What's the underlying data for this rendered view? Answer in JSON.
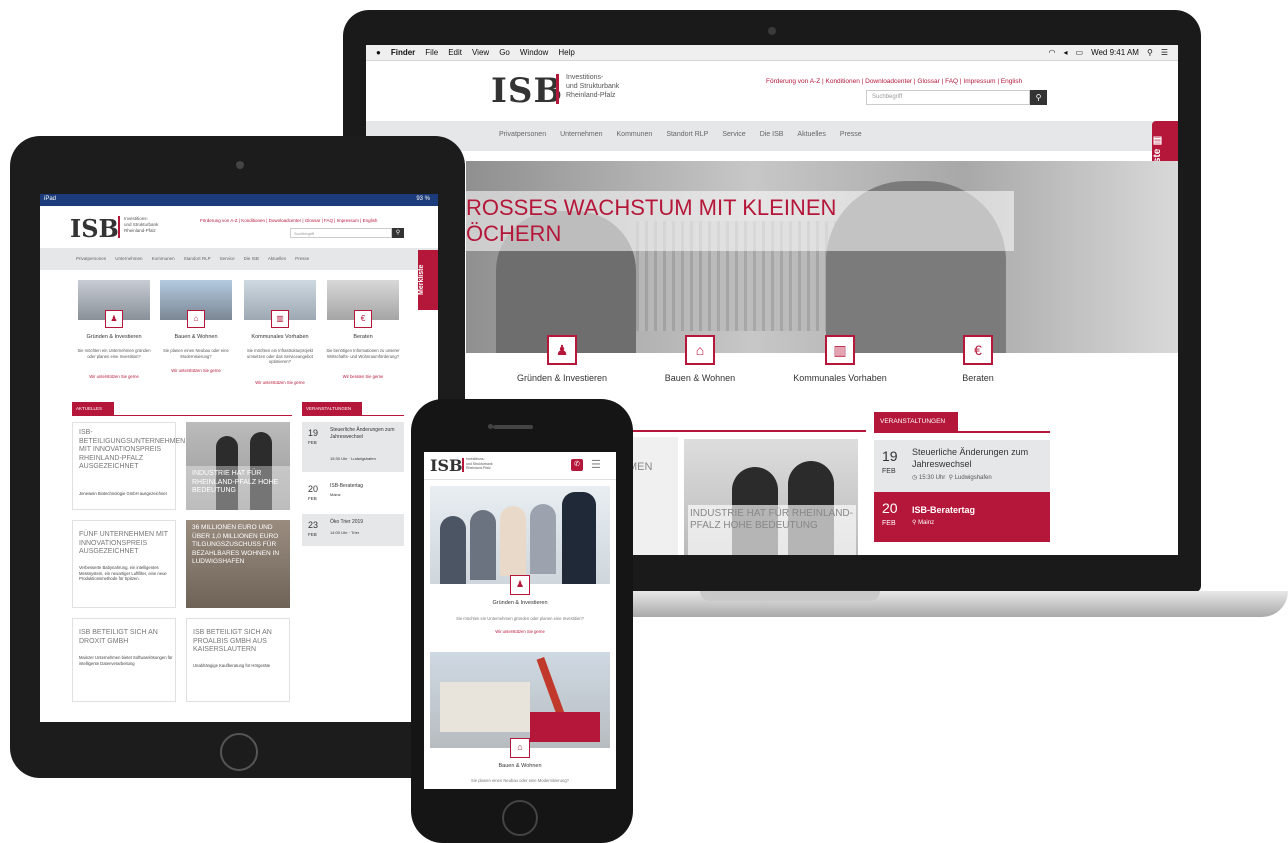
{
  "brand": {
    "logo": "ISB",
    "name_line1": "Investitions-",
    "name_line2": "und Strukturbank",
    "name_line3": "Rheinland-Pfalz",
    "accent_color": "#b5173a"
  },
  "mac_menubar": {
    "apple": "",
    "items": [
      "Finder",
      "File",
      "Edit",
      "View",
      "Go",
      "Window",
      "Help"
    ],
    "clock": "Wed 9:41 AM"
  },
  "top_links": "Förderung von A-Z | Konditionen | Downloadcenter | Glossar | FAQ | Impressum | English",
  "search": {
    "placeholder": "Suchbegriff",
    "button_icon": "search-icon"
  },
  "nav": [
    "Privatpersonen",
    "Unternehmen",
    "Kommunen",
    "Standort RLP",
    "Service",
    "Die ISB",
    "Aktuelles",
    "Presse"
  ],
  "merkliste": "Merkliste",
  "hero": {
    "title_line1": "ROSSES WACHSTUM MIT KLEINEN",
    "title_line2": "ÖCHERN"
  },
  "categories": [
    {
      "label": "Gründen & Investieren",
      "icon": "people-icon",
      "glyph": "👥",
      "desc": "Sie möchten ein Unternehmen gründen oder planen eine Investition?",
      "link": "Wir unterstützen Sie gerne"
    },
    {
      "label": "Bauen & Wohnen",
      "icon": "house-icon",
      "glyph": "⌂",
      "desc": "Sie planen einen Neubau oder eine Modernisierung?",
      "link": "Wir unterstützen Sie gerne"
    },
    {
      "label": "Kommunales Vorhaben",
      "icon": "municipal-icon",
      "glyph": "▥",
      "desc": "Sie möchten ein Infrastrukturprojekt umsetzen oder das Serviceangebot optimieren?",
      "link": "Wir unterstützen Sie gerne"
    },
    {
      "label": "Beraten",
      "icon": "advice-icon",
      "glyph": "€",
      "desc": "Sie benötigen Informationen zu unserer Wirtschafts- und Wohnraumförderung?",
      "link": "Wir beraten Sie gerne"
    }
  ],
  "laptop": {
    "news_partial": "MEN",
    "news_card_title": "INDUSTRIE HAT FÜR RHEINLAND-PFALZ HOHE BEDEUTUNG",
    "events_heading": "VERANSTALTUNGEN",
    "events": [
      {
        "day": "19",
        "month": "FEB",
        "title": "Steuerliche Änderungen zum Jahreswechsel",
        "time": "15:30 Uhr",
        "place": "Ludwigshafen"
      },
      {
        "day": "20",
        "month": "FEB",
        "title": "ISB-Beratertag",
        "place": "Mainz"
      }
    ]
  },
  "tablet": {
    "status_left": "iPad",
    "status_right": "93 %",
    "news_heading": "AKTUELLES",
    "events_heading": "VERANSTALTUNGEN",
    "news": [
      {
        "title": "ISB-BETEILIGUNGSUNTERNEHMEN MIT INNOVATIONSPREIS RHEINLAND-PFALZ AUSGEZEICHNET",
        "text": "Jenewein Biotechnologie GmbH ausgezeichnet"
      },
      {
        "title": "FÜNF UNTERNEHMEN MIT INNOVATIONSPREIS AUSGEZEICHNET",
        "text": "Verbesserte Babynahrung, ein intelligentes Messsystem, ein neuartiger Luftfilter, eine neue Produktionsmethode für Spitzen."
      },
      {
        "title": "ISB BETEILIGT SICH AN DROXIT GMBH",
        "text": "Mainzer Unternehmen bietet Softwarelösungen für intelligente Datenverarbeitung"
      },
      {
        "title": "INDUSTRIE HAT FÜR RHEINLAND-PFALZ HOHE BEDEUTUNG",
        "text": ""
      },
      {
        "title": "36 MILLIONEN EURO UND ÜBER 1,0 MILLIONEN EURO TILGUNGSZUSCHUSS FÜR BEZAHLBARES WOHNEN IN LUDWIGSHAFEN",
        "text": ""
      },
      {
        "title": "ISB BETEILIGT SICH AN PROALBIS GMBH AUS KAISERSLAUTERN",
        "text": "Unabhängige Kaufberatung für Hörgeräte"
      }
    ],
    "events": [
      {
        "day": "19",
        "month": "FEB",
        "title": "Steuerliche Änderungen zum Jahreswechsel",
        "meta": "15:30 Uhr · Ludwigshafen"
      },
      {
        "day": "20",
        "month": "FEB",
        "title": "ISB-Beratertag",
        "meta": "Mainz"
      },
      {
        "day": "23",
        "month": "FEB",
        "title": "Öko Trier 2019",
        "meta": "14:00 Uhr · Trier"
      }
    ]
  },
  "phone": {
    "cat1": {
      "label": "Gründen & Investieren",
      "desc": "Sie möchten ein Unternehmen gründen oder planen eine Investition?",
      "link": "Wir unterstützen Sie gerne"
    },
    "cat2": {
      "label": "Bauen & Wohnen",
      "desc": "Sie planen einen Neubau oder eine Modernisierung?"
    }
  }
}
